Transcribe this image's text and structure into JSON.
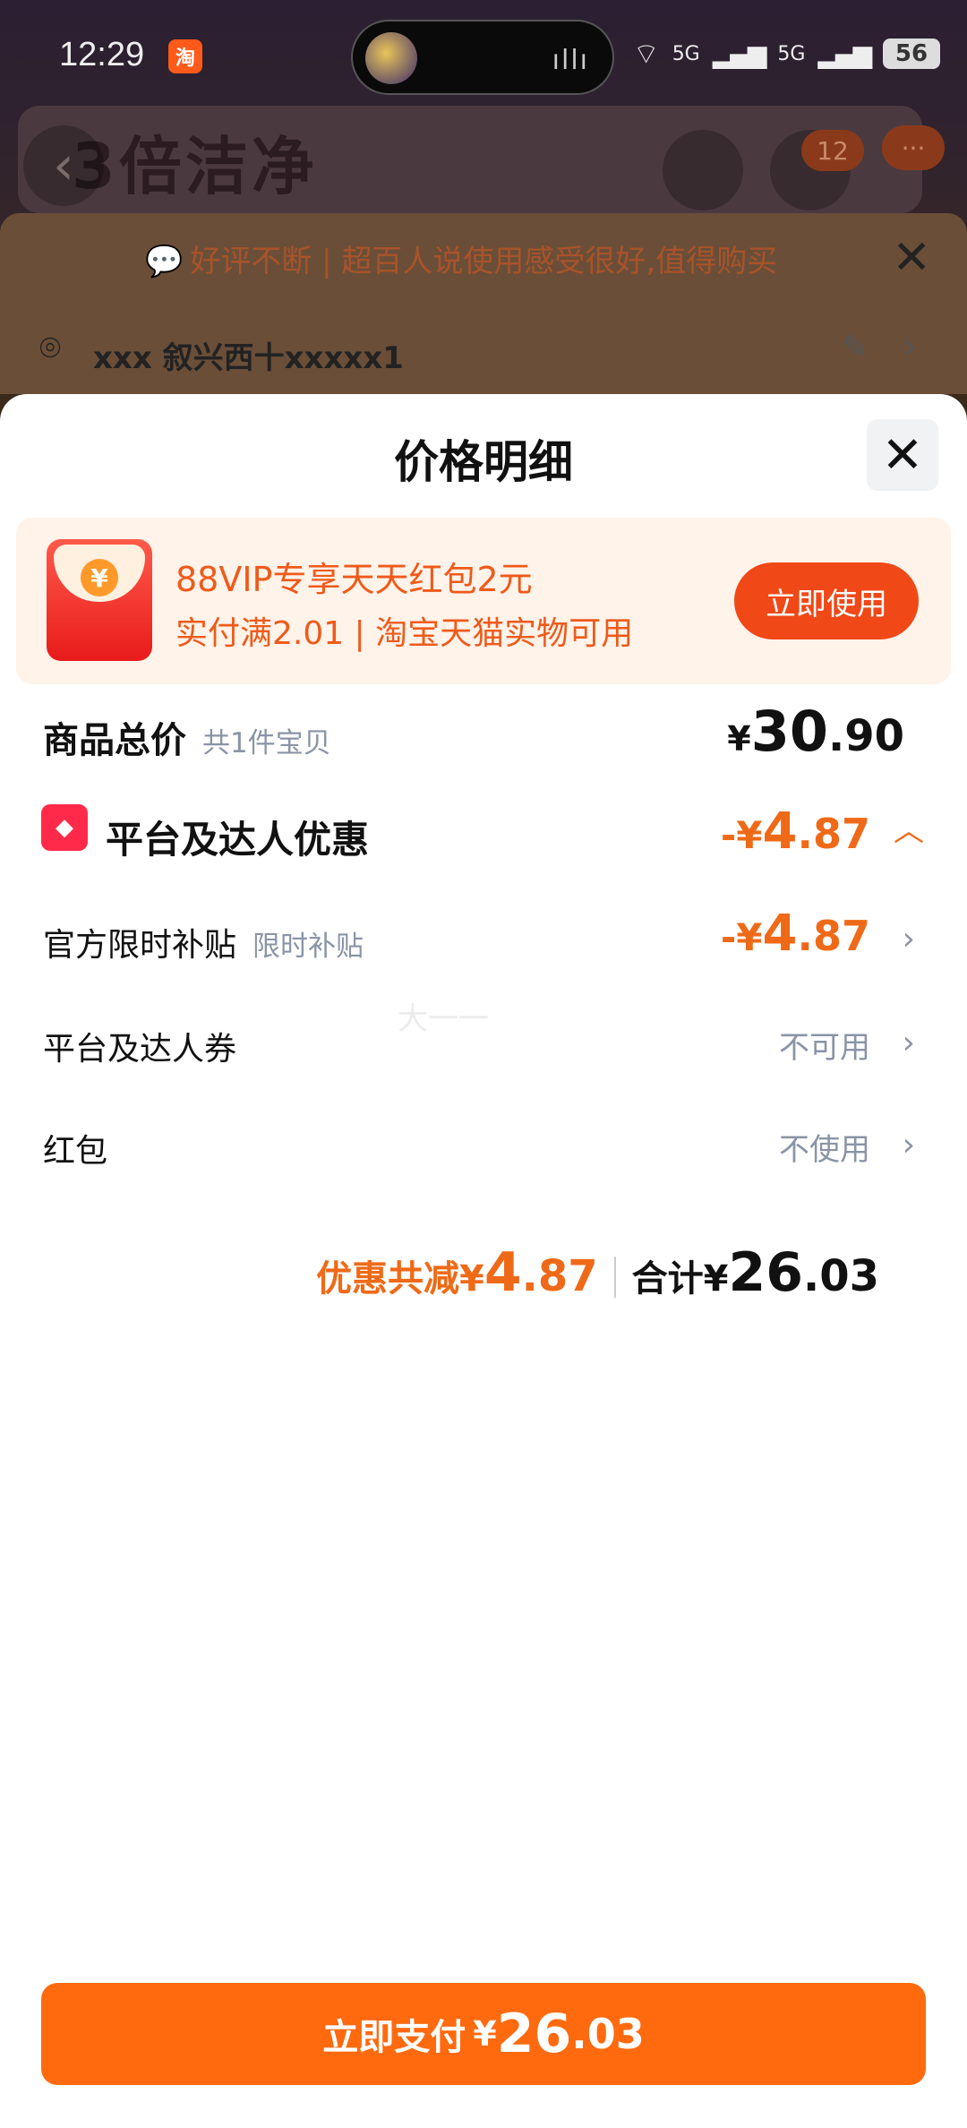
{
  "status_bar": {
    "time": "12:29",
    "app_icon_text": "淘",
    "signal_1": "5G",
    "signal_2": "5G",
    "battery": "56"
  },
  "background": {
    "banner_text": "3倍洁净",
    "cart_count": "12",
    "more_label": "···"
  },
  "notice": {
    "text": "好评不断 | 超百人说使用感受很好,值得购买"
  },
  "address": {
    "text": "xxx 叙兴西十xxxxx1"
  },
  "sheet": {
    "title": "价格明细",
    "watermark": "大一一",
    "promo": {
      "line1": "88VIP专享天天红包2元",
      "line2": "实付满2.01 | 淘宝天猫实物可用",
      "button": "立即使用"
    },
    "total": {
      "label": "商品总价",
      "sub": "共1件宝贝",
      "currency": "¥",
      "int": "30",
      "dec": ".90"
    },
    "platform": {
      "label": "平台及达人优惠",
      "prefix": "-¥",
      "int": "4",
      "dec": ".87"
    },
    "official": {
      "label": "官方限时补贴",
      "sub": "限时补贴",
      "prefix": "-¥",
      "int": "4",
      "dec": ".87"
    },
    "coupon": {
      "label": "平台及达人券",
      "value": "不可用"
    },
    "red_packet": {
      "label": "红包",
      "value": "不使用"
    },
    "summary": {
      "discount_label": "优惠共减¥",
      "discount_int": "4",
      "discount_dec": ".87",
      "total_label": "合计¥",
      "total_int": "26",
      "total_dec": ".03"
    },
    "pay": {
      "label": "立即支付",
      "currency": "¥",
      "int": "26",
      "dec": ".03"
    }
  }
}
